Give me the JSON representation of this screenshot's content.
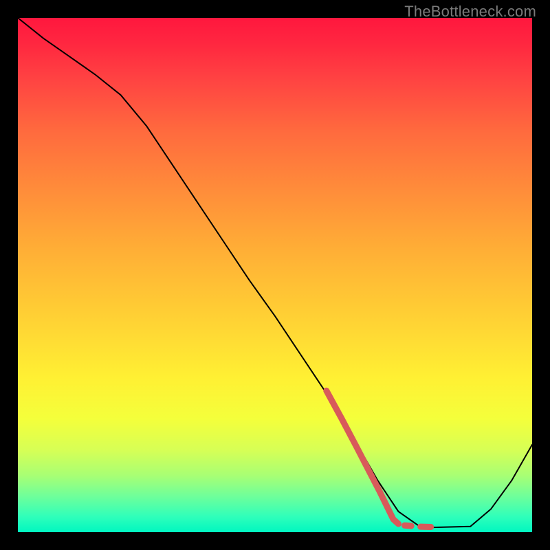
{
  "watermark": "TheBottleneck.com",
  "chart_data": {
    "type": "line",
    "title": "",
    "xlabel": "",
    "ylabel": "",
    "xlim": [
      0,
      100
    ],
    "ylim": [
      0,
      100
    ],
    "grid": false,
    "series": [
      {
        "name": "curve",
        "x": [
          0,
          5,
          10,
          15,
          20,
          25,
          30,
          35,
          40,
          45,
          50,
          55,
          60,
          62,
          66,
          70,
          74,
          78,
          80,
          84,
          88,
          92,
          96,
          100
        ],
        "y": [
          100,
          96,
          92.5,
          89,
          85,
          79,
          71.5,
          64,
          56.5,
          49,
          42,
          34.5,
          27,
          24,
          17,
          10,
          4,
          1.2,
          0.9,
          1.0,
          1.1,
          4.5,
          10,
          17
        ],
        "color": "#000000",
        "width": 2
      },
      {
        "name": "highlight",
        "x": [
          60,
          63,
          66,
          67.5,
          69,
          70.3,
          73,
          74
        ],
        "y": [
          27.5,
          22,
          16.3,
          13.4,
          10.5,
          8.0,
          2.5,
          1.6
        ],
        "color": "#d85a5a",
        "width": 9
      },
      {
        "name": "highlight-dot-1",
        "x": [
          75.2,
          76.5
        ],
        "y": [
          1.3,
          1.2
        ],
        "color": "#d85a5a",
        "width": 9
      },
      {
        "name": "highlight-dot-2",
        "x": [
          78.3,
          80.3
        ],
        "y": [
          1.05,
          1.0
        ],
        "color": "#d85a5a",
        "width": 9
      }
    ]
  }
}
